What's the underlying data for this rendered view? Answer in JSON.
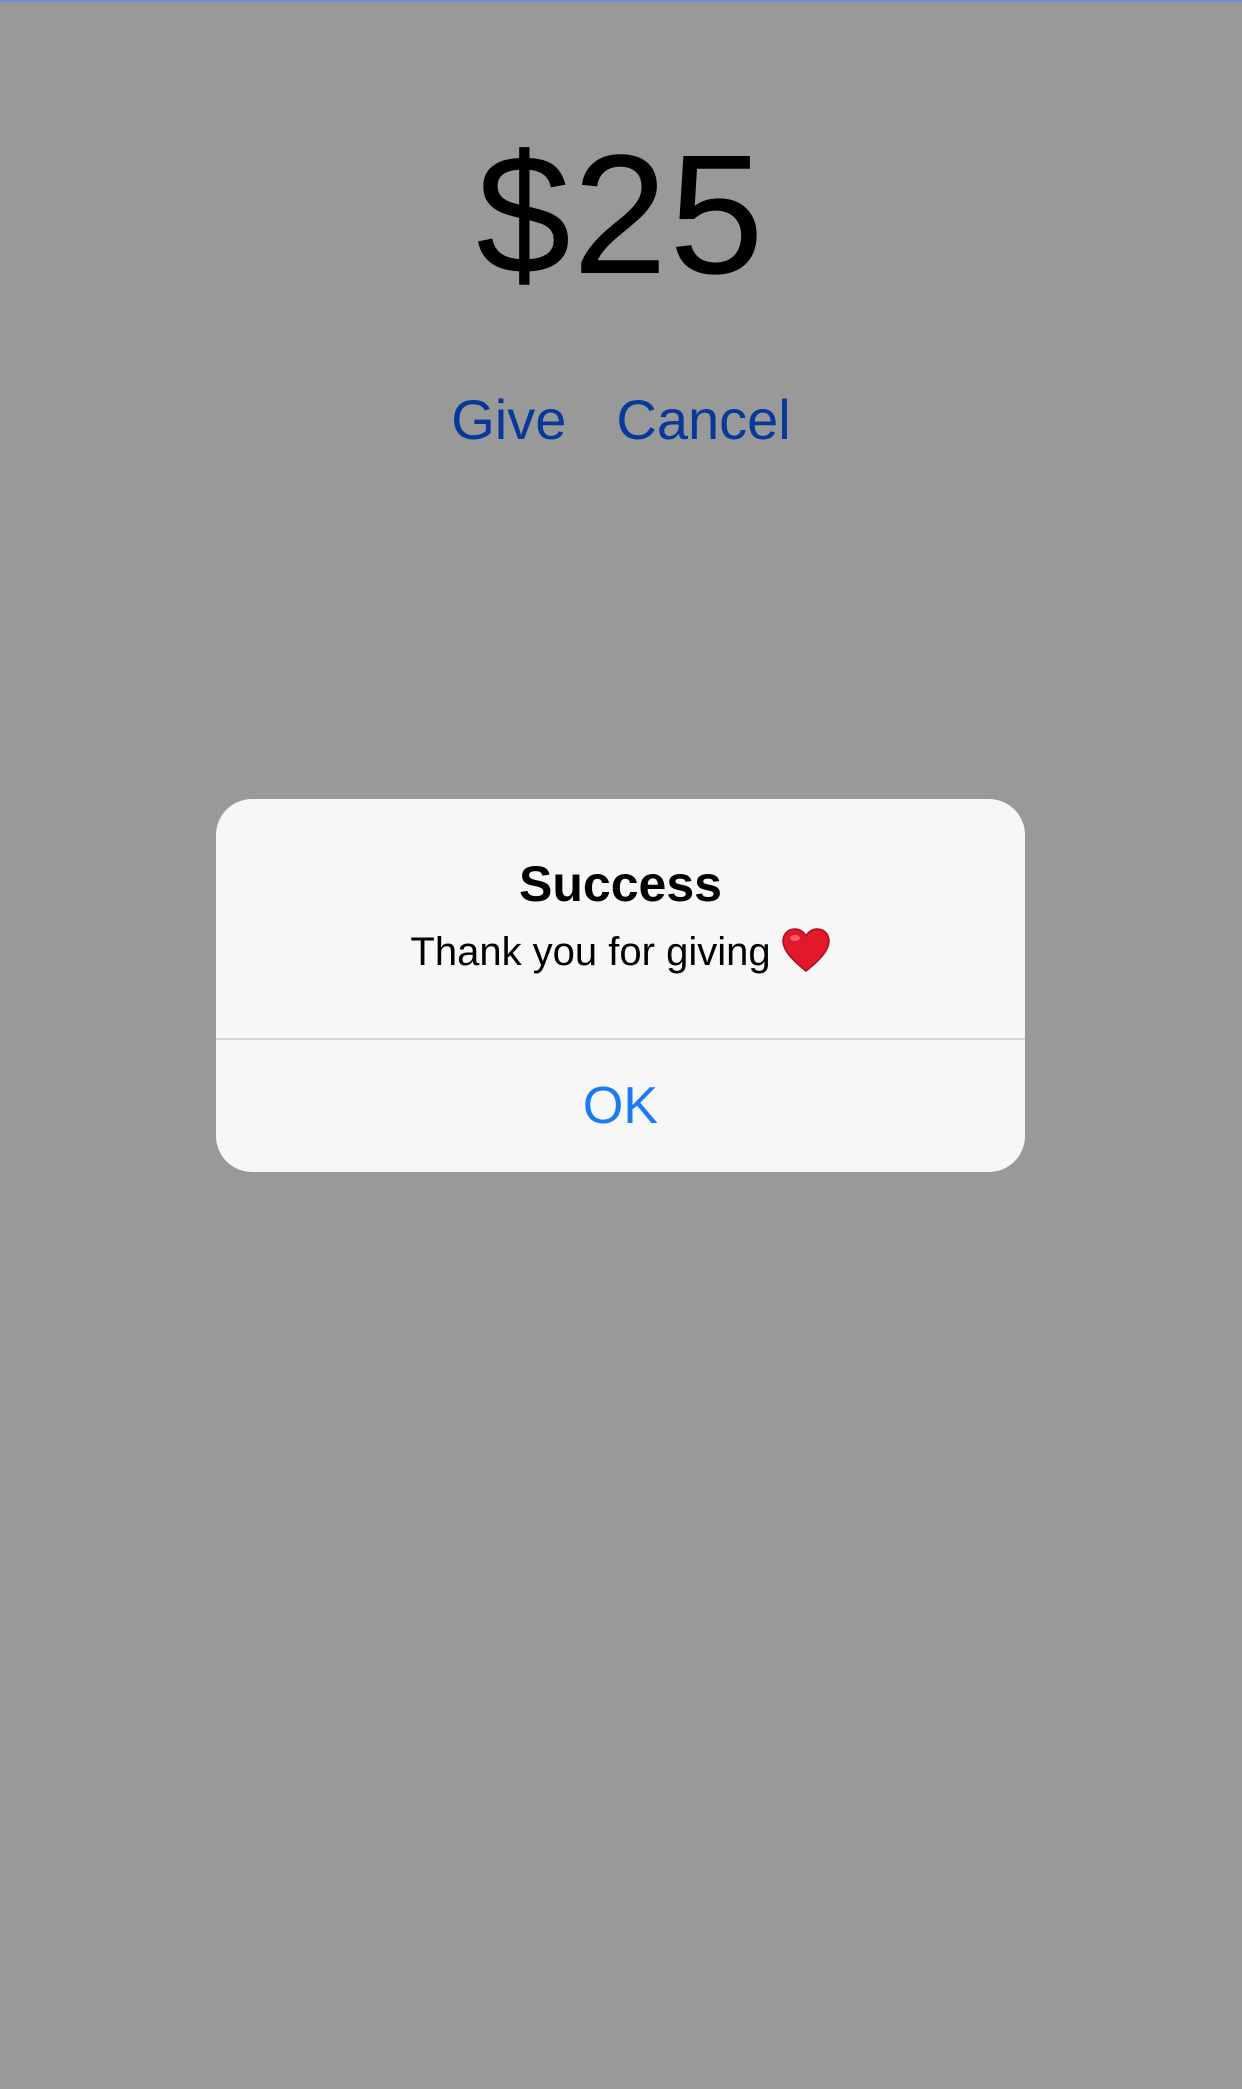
{
  "screen": {
    "amount": "$25",
    "give_label": "Give",
    "cancel_label": "Cancel"
  },
  "alert": {
    "title": "Success",
    "message": "Thank you for giving",
    "message_icon": "heart-icon",
    "ok_label": "OK"
  },
  "colors": {
    "accent": "#0a60ff",
    "alert_button": "#1a7cf2",
    "heart": "#e1192a"
  }
}
